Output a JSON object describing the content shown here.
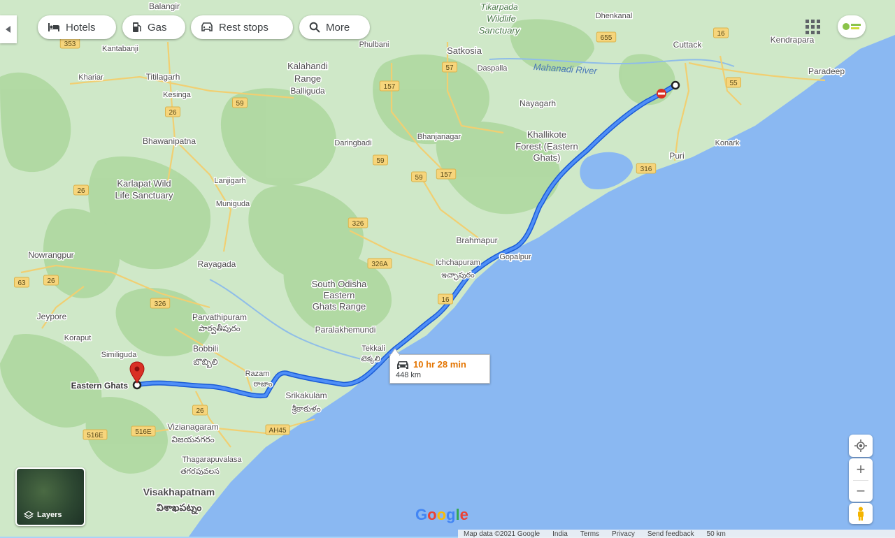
{
  "toolbar": {
    "hotels": "Hotels",
    "gas": "Gas",
    "rest_stops": "Rest stops",
    "more": "More"
  },
  "route": {
    "duration": "10 hr 28 min",
    "distance": "448 km",
    "destination": "Eastern Ghats",
    "route_color": "#4285f4"
  },
  "places": {
    "balangir": "Balangir",
    "tikarpada": "Tikarpada",
    "wildlife": "Wildlife",
    "sanctuary": "Sanctuary",
    "dhenkanal": "Dhenkanal",
    "kantabanji": "Kantabanji",
    "phulbani": "Phulbani",
    "satkosia": "Satkosia",
    "cuttack": "Cuttack",
    "kendrapara": "Kendrapara",
    "kalahandi": "Kalahandi",
    "range": "Range",
    "balliguda": "Balliguda",
    "daspalla": "Daspalla",
    "mahanadi": "Mahanadi River",
    "paradeep": "Paradeep",
    "khariar": "Khariar",
    "titilagarh": "Titilagarh",
    "kesinga": "Kesinga",
    "nayagarh": "Nayagarh",
    "bhawanipatna": "Bhawanipatna",
    "daringbadi": "Daringbadi",
    "bhanjanagar": "Bhanjanagar",
    "khallikote": "Khallikote",
    "forest_eastern": "Forest (Eastern",
    "ghats_paren": "Ghats)",
    "konark": "Konark",
    "puri": "Puri",
    "karlapat": "Karlapat Wild",
    "life_sanctuary": "Life Sanctuary",
    "lanjigarh": "Lanjigarh",
    "muniguda": "Muniguda",
    "brahmapur": "Brahmapur",
    "nowrangpur": "Nowrangpur",
    "rayagada": "Rayagada",
    "ichchapuram": "Ichchapuram",
    "ichchapuram_te": "ఇచ్ఛాపురం",
    "gopalpur": "Gopalpur",
    "south_odisha": "South Odisha",
    "eastern": "Eastern",
    "ghats_range": "Ghats Range",
    "jeypore": "Jeypore",
    "parvathipuram": "Parvathipuram",
    "parvathipuram_te": "పార్వతీపురం",
    "paralakhemundi": "Paralakhemundi",
    "koraput": "Koraput",
    "bobbili": "Bobbili",
    "bobbili_te": "బొబ్బిలి",
    "tekkali": "Tekkali",
    "tekkali_te": "టెక్కలి",
    "simliguda": "Similiguda",
    "razam": "Razam",
    "razam_te": "రాజాం",
    "srikakulam": "Srikakulam",
    "srikakulam_te": "శ్రీకాకుళం",
    "vizianagaram": "Vizianagaram",
    "vizianagaram_te": "విజయనగరం",
    "thagarapuvalasa": "Thagarapuvalasa",
    "thagarapuvalasa_te": "తగరపువలస",
    "visakhapatnam": "Visakhapatnam",
    "visakhapatnam_te": "విశాఖపట్నం"
  },
  "roads": [
    "353",
    "655",
    "16",
    "57",
    "157",
    "59",
    "26",
    "59",
    "59",
    "157",
    "316",
    "55",
    "26",
    "326",
    "326A",
    "16",
    "63",
    "26",
    "326",
    "26",
    "516E",
    "516E",
    "AH45"
  ],
  "controls": {
    "layers": "Layers",
    "zoom_in": "+",
    "zoom_out": "−"
  },
  "branding": {
    "logo": "Google"
  },
  "footer": {
    "map_data": "Map data ©2021 Google",
    "india": "India",
    "terms": "Terms",
    "privacy": "Privacy",
    "feedback": "Send feedback",
    "scale": "50 km"
  },
  "colors": {
    "land": "#cfe8c8",
    "forest": "#a9d49b",
    "sea": "#8ab8f2",
    "road": "#f3d37a",
    "route": "#4285f4",
    "pin": "#d93025",
    "duration": "#e37400"
  }
}
